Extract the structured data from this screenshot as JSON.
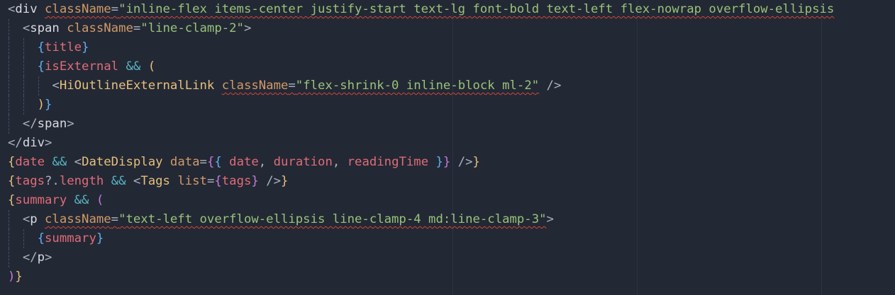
{
  "editor": {
    "lines": [
      {
        "indent": 0,
        "tokens": [
          {
            "t": "<",
            "c": "punc"
          },
          {
            "t": "div",
            "c": "tag"
          },
          {
            "t": " ",
            "c": "punc"
          },
          {
            "t": "className",
            "c": "attr",
            "sq": true
          },
          {
            "t": "=",
            "c": "punc",
            "sq": true
          },
          {
            "t": "\"inline-flex items-center justify-start text-lg font-bold text-left flex-nowrap overflow-ellipsis",
            "c": "str",
            "sq": true
          }
        ]
      },
      {
        "indent": 1,
        "tokens": [
          {
            "t": "<",
            "c": "punc"
          },
          {
            "t": "span",
            "c": "tag"
          },
          {
            "t": " ",
            "c": "punc"
          },
          {
            "t": "className",
            "c": "attr"
          },
          {
            "t": "=",
            "c": "punc"
          },
          {
            "t": "\"line-clamp-2\"",
            "c": "str"
          },
          {
            "t": ">",
            "c": "punc"
          }
        ]
      },
      {
        "indent": 2,
        "tokens": [
          {
            "t": "{",
            "c": "bracket-b"
          },
          {
            "t": "title",
            "c": "var"
          },
          {
            "t": "}",
            "c": "bracket-b"
          }
        ]
      },
      {
        "indent": 2,
        "tokens": [
          {
            "t": "{",
            "c": "bracket-b"
          },
          {
            "t": "isExternal",
            "c": "var"
          },
          {
            "t": " ",
            "c": "punc"
          },
          {
            "t": "&&",
            "c": "op"
          },
          {
            "t": " ",
            "c": "punc"
          },
          {
            "t": "(",
            "c": "bracket-y"
          }
        ]
      },
      {
        "indent": 3,
        "tokens": [
          {
            "t": "<",
            "c": "punc"
          },
          {
            "t": "HiOutlineExternalLink",
            "c": "tagname"
          },
          {
            "t": " ",
            "c": "punc"
          },
          {
            "t": "className",
            "c": "attr",
            "sq": true
          },
          {
            "t": "=",
            "c": "punc",
            "sq": true
          },
          {
            "t": "\"flex-shrink-0 inline-block ml-2\"",
            "c": "str",
            "sq": true
          },
          {
            "t": " ",
            "c": "punc"
          },
          {
            "t": "/>",
            "c": "punc"
          }
        ]
      },
      {
        "indent": 2,
        "tokens": [
          {
            "t": ")",
            "c": "bracket-y"
          },
          {
            "t": "}",
            "c": "bracket-b"
          }
        ]
      },
      {
        "indent": 1,
        "tokens": [
          {
            "t": "</",
            "c": "punc"
          },
          {
            "t": "span",
            "c": "tag"
          },
          {
            "t": ">",
            "c": "punc"
          }
        ]
      },
      {
        "indent": 0,
        "tokens": [
          {
            "t": "</",
            "c": "punc"
          },
          {
            "t": "div",
            "c": "tag"
          },
          {
            "t": ">",
            "c": "punc"
          }
        ]
      },
      {
        "indent": 0,
        "tokens": [
          {
            "t": "{",
            "c": "bracket-y"
          },
          {
            "t": "date",
            "c": "var"
          },
          {
            "t": " ",
            "c": "punc"
          },
          {
            "t": "&&",
            "c": "op"
          },
          {
            "t": " ",
            "c": "punc"
          },
          {
            "t": "<",
            "c": "punc"
          },
          {
            "t": "DateDisplay",
            "c": "tagname"
          },
          {
            "t": " ",
            "c": "punc"
          },
          {
            "t": "data",
            "c": "attr"
          },
          {
            "t": "=",
            "c": "punc"
          },
          {
            "t": "{",
            "c": "bracket-p"
          },
          {
            "t": "{",
            "c": "bracket-b"
          },
          {
            "t": " ",
            "c": "punc"
          },
          {
            "t": "date",
            "c": "var"
          },
          {
            "t": ", ",
            "c": "punc"
          },
          {
            "t": "duration",
            "c": "var"
          },
          {
            "t": ", ",
            "c": "punc"
          },
          {
            "t": "readingTime",
            "c": "var"
          },
          {
            "t": " ",
            "c": "punc"
          },
          {
            "t": "}",
            "c": "bracket-b"
          },
          {
            "t": "}",
            "c": "bracket-p"
          },
          {
            "t": " ",
            "c": "punc"
          },
          {
            "t": "/>",
            "c": "punc"
          },
          {
            "t": "}",
            "c": "bracket-y"
          }
        ]
      },
      {
        "indent": 0,
        "tokens": [
          {
            "t": "{",
            "c": "bracket-y"
          },
          {
            "t": "tags",
            "c": "var"
          },
          {
            "t": "?.",
            "c": "punc"
          },
          {
            "t": "length",
            "c": "var"
          },
          {
            "t": " ",
            "c": "punc"
          },
          {
            "t": "&&",
            "c": "op"
          },
          {
            "t": " ",
            "c": "punc"
          },
          {
            "t": "<",
            "c": "punc"
          },
          {
            "t": "Tags",
            "c": "tagname"
          },
          {
            "t": " ",
            "c": "punc"
          },
          {
            "t": "list",
            "c": "attr"
          },
          {
            "t": "=",
            "c": "punc"
          },
          {
            "t": "{",
            "c": "bracket-p"
          },
          {
            "t": "tags",
            "c": "var"
          },
          {
            "t": "}",
            "c": "bracket-p"
          },
          {
            "t": " ",
            "c": "punc"
          },
          {
            "t": "/>",
            "c": "punc"
          },
          {
            "t": "}",
            "c": "bracket-y"
          }
        ]
      },
      {
        "indent": 0,
        "tokens": [
          {
            "t": "{",
            "c": "bracket-y"
          },
          {
            "t": "summary",
            "c": "var"
          },
          {
            "t": " ",
            "c": "punc"
          },
          {
            "t": "&&",
            "c": "op"
          },
          {
            "t": " ",
            "c": "punc"
          },
          {
            "t": "(",
            "c": "bracket-p"
          }
        ]
      },
      {
        "indent": 1,
        "tokens": [
          {
            "t": "<",
            "c": "punc"
          },
          {
            "t": "p",
            "c": "tag"
          },
          {
            "t": " ",
            "c": "punc"
          },
          {
            "t": "className",
            "c": "attr",
            "sq": true
          },
          {
            "t": "=",
            "c": "punc",
            "sq": true
          },
          {
            "t": "\"text-left overflow-ellipsis line-clamp-4 md:line-clamp-3\"",
            "c": "str",
            "sq": true
          },
          {
            "t": ">",
            "c": "punc"
          }
        ]
      },
      {
        "indent": 2,
        "tokens": [
          {
            "t": "{",
            "c": "bracket-b"
          },
          {
            "t": "summary",
            "c": "var"
          },
          {
            "t": "}",
            "c": "bracket-b"
          }
        ]
      },
      {
        "indent": 1,
        "tokens": [
          {
            "t": "</",
            "c": "punc"
          },
          {
            "t": "p",
            "c": "tag"
          },
          {
            "t": ">",
            "c": "punc"
          }
        ]
      },
      {
        "indent": 0,
        "tokens": [
          {
            "t": ")",
            "c": "bracket-p"
          },
          {
            "t": "}",
            "c": "bracket-y"
          }
        ]
      }
    ]
  }
}
